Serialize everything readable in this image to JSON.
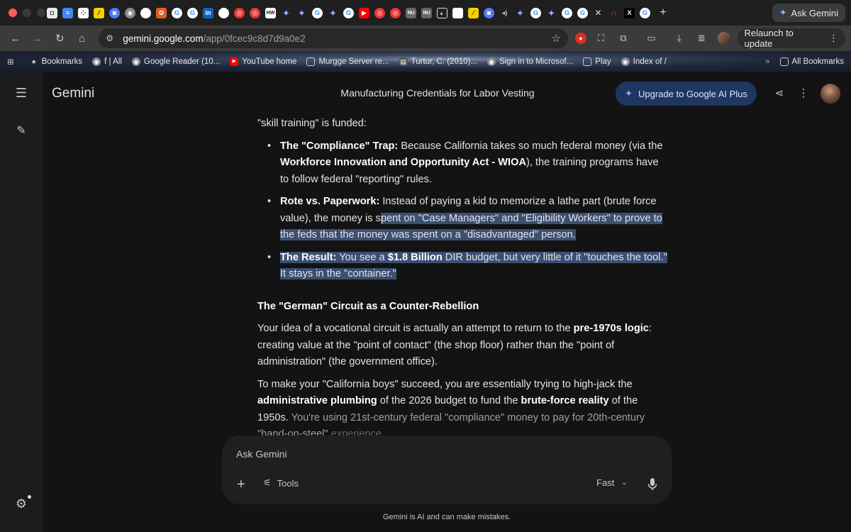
{
  "tabs": {
    "icons": [
      "tab-favicon",
      "docs-favicon",
      "dice-favicon",
      "yellow-favicon",
      "round-favicon",
      "chrome-favicon",
      "white-circle-favicon",
      "puzzle-favicon",
      "google-favicon",
      "google-favicon",
      "linkedin-favicon",
      "white-circle-favicon",
      "red-favicon",
      "red-favicon",
      "hw-favicon",
      "gemini-favicon",
      "gemini-favicon",
      "google-favicon",
      "gemini-favicon",
      "google-favicon",
      "youtube-favicon",
      "red-favicon",
      "red-favicon",
      "nu-favicon",
      "nu-favicon",
      "dark-favicon",
      "white-square-favicon",
      "yellow-favicon",
      "round-favicon",
      "speaker-favicon",
      "gemini-favicon",
      "google-favicon",
      "gemini-favicon",
      "google-favicon",
      "google-favicon",
      "close-tab",
      "headphones-favicon",
      "x-favicon",
      "google-favicon"
    ],
    "labels": {
      "linkedin": "in",
      "hw": "HW",
      "nu": "NU",
      "x": "X"
    },
    "new_tab_label": "+",
    "ask_gemini_label": "Ask Gemini"
  },
  "toolbar": {
    "url_host": "gemini.google.com",
    "url_path": "/app/0fcec9c8d7d9a0e2",
    "relaunch_label": "Relaunch to update"
  },
  "bookmarks": {
    "items": [
      {
        "label": "Bookmarks"
      },
      {
        "label": "f | All"
      },
      {
        "label": "Google Reader (10..."
      },
      {
        "label": "YouTube home"
      },
      {
        "label": "Murgge Server re..."
      },
      {
        "label": "Turtur, C. (2010)..."
      },
      {
        "label": "Sign in to Microsof..."
      },
      {
        "label": "Play"
      },
      {
        "label": "Index of /"
      }
    ],
    "all_label": "All Bookmarks"
  },
  "header": {
    "app_name": "Gemini",
    "conversation_title": "Manufacturing Credentials for Labor Vesting",
    "upgrade_label": "Upgrade to Google AI Plus"
  },
  "conversation": {
    "intro": "\"skill training\" is funded:",
    "bullet1": {
      "lead": "The \"Compliance\" Trap:",
      "text1": " Because California takes so much federal money (via the ",
      "bold": "Workforce Innovation and Opportunity Act - WIOA",
      "text2": "), the training programs have to follow federal \"reporting\" rules."
    },
    "bullet2": {
      "lead": "Rote vs. Paperwork:",
      "text1": " Instead of paying a kid to memorize a lathe part (brute force value), the money is s",
      "sel": "pent on \"Case Managers\" and \"Eligibility Workers\" to prove to the feds that the money was spent on a \"disadvantaged\" person."
    },
    "bullet3": {
      "lead": "The Result:",
      "text1": " You see a ",
      "bold": "$1.8 Billion",
      "text2": " DIR budget, but very little of it \"touches the tool.\" It stays in the \"container.\""
    },
    "heading": "The \"German\" Circuit as a Counter-Rebellion",
    "para1": {
      "text1": "Your idea of a vocational circuit is actually an attempt to return to the ",
      "bold": "pre-1970s logic",
      "text2": ": creating value at the \"point of contact\" (the shop floor) rather than the \"point of administration\" (the government office)."
    },
    "para2": {
      "text1": "To make your \"California boys\" succeed, you are essentially trying to high-jack the ",
      "bold1": "administrative plumbing",
      "text2": " of the 2026 budget to fund the ",
      "bold2": "brute-force reality",
      "text3": " of the 1950s. ",
      "fade": "You're using 21st-century federal \"compliance\" money to pay for 20th-century \"hand-on-steel\" ",
      "fade2": "experience."
    }
  },
  "composer": {
    "placeholder": "Ask Gemini",
    "tools_label": "Tools",
    "mode_label": "Fast"
  },
  "footer": {
    "disclaimer": "Gemini is AI and can make mistakes."
  },
  "colors": {
    "accent": "#1f3760",
    "selection": "#3b4f73",
    "background": "#131314"
  }
}
